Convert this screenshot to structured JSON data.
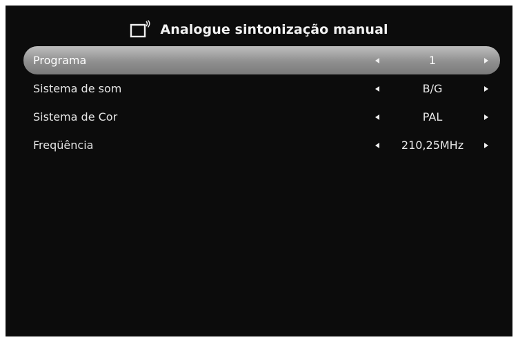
{
  "header": {
    "icon": "tv-antenna-icon",
    "title": "Analogue sintonização manual"
  },
  "menu": {
    "items": [
      {
        "label": "Programa",
        "value": "1",
        "selected": true
      },
      {
        "label": "Sistema de som",
        "value": "B/G",
        "selected": false
      },
      {
        "label": "Sistema de Cor",
        "value": "PAL",
        "selected": false
      },
      {
        "label": "Freqüência",
        "value": "210,25MHz",
        "selected": false
      }
    ]
  },
  "colors": {
    "background": "#0c0c0c",
    "selected_row": "#9a9a9a",
    "text": "#e6e6e6"
  }
}
